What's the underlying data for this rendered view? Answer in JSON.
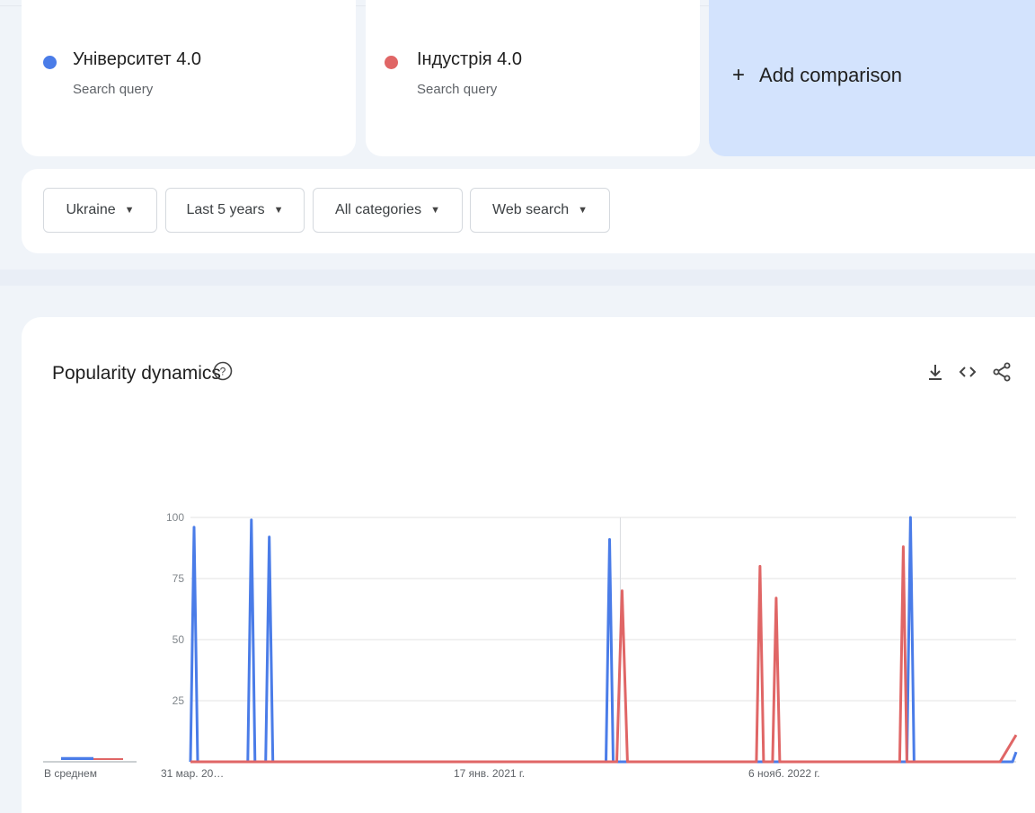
{
  "terms": [
    {
      "name": "Університет 4.0",
      "type": "Search query",
      "color": "#4a7ce8"
    },
    {
      "name": "Індустрія 4.0",
      "type": "Search query",
      "color": "#e06666"
    }
  ],
  "add_comparison": {
    "icon": "plus-icon",
    "label": "Add comparison"
  },
  "filters": [
    {
      "label": "Ukraine"
    },
    {
      "label": "Last 5 years"
    },
    {
      "label": "All categories"
    },
    {
      "label": "Web search"
    }
  ],
  "chart_section": {
    "title": "Popularity dynamics",
    "help_icon": "help-circle-icon",
    "actions": [
      "download-icon",
      "embed-code-icon",
      "share-icon"
    ],
    "average_label": "В среднем"
  },
  "chart_data": {
    "type": "line",
    "ylim": [
      0,
      100
    ],
    "yticks": [
      "100",
      "75",
      "50",
      "25"
    ],
    "xtick_labels": [
      "31 мар. 20…",
      "17 янв. 2021 г.",
      "6 нояб. 2022 г."
    ],
    "averages": [
      {
        "series": "Університет 4.0",
        "value": 2
      },
      {
        "series": "Індустрія 4.0",
        "value": 1
      }
    ],
    "series": [
      {
        "name": "Університет 4.0",
        "color": "#4a7ce8",
        "points": [
          [
            0,
            0
          ],
          [
            2,
            96
          ],
          [
            4,
            0
          ],
          [
            32,
            0
          ],
          [
            34,
            99
          ],
          [
            36,
            0
          ],
          [
            42,
            0
          ],
          [
            44,
            92
          ],
          [
            46,
            0
          ],
          [
            232,
            0
          ],
          [
            234,
            91
          ],
          [
            236,
            0
          ],
          [
            400,
            0
          ],
          [
            402,
            100
          ],
          [
            404,
            0
          ],
          [
            459,
            0
          ],
          [
            461,
            4
          ]
        ]
      },
      {
        "name": "Індустрія 4.0",
        "color": "#e06666",
        "points": [
          [
            0,
            0
          ],
          [
            238,
            0
          ],
          [
            241,
            70
          ],
          [
            244,
            0
          ],
          [
            316,
            0
          ],
          [
            318,
            80
          ],
          [
            320,
            0
          ],
          [
            325,
            0
          ],
          [
            327,
            67
          ],
          [
            329,
            0
          ],
          [
            396,
            0
          ],
          [
            398,
            88
          ],
          [
            400,
            0
          ],
          [
            452,
            0
          ],
          [
            461,
            11
          ]
        ]
      }
    ],
    "x_domain": [
      0,
      461
    ],
    "marker_x": 240
  }
}
